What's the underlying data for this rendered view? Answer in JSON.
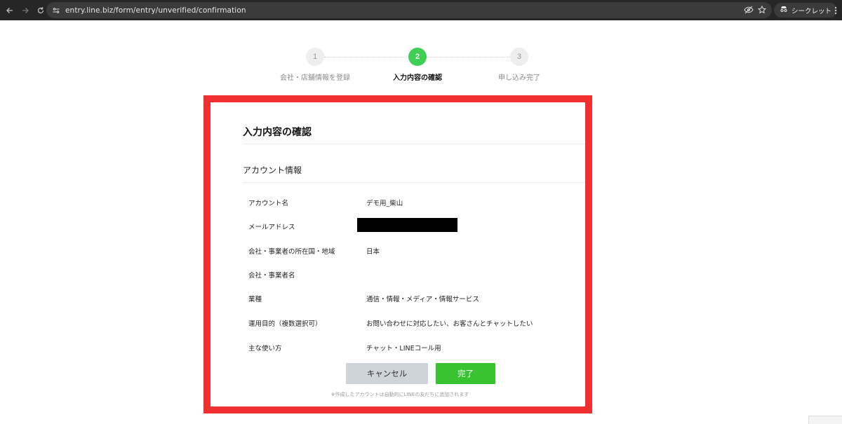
{
  "browser": {
    "url": "entry.line.biz/form/entry/unverified/confirmation",
    "incognito_label": "シークレット"
  },
  "stepper": {
    "steps": [
      {
        "number": "1",
        "label": "会社・店舗情報を登録",
        "state": "inactive"
      },
      {
        "number": "2",
        "label": "入力内容の確認",
        "state": "active"
      },
      {
        "number": "3",
        "label": "申し込み完了",
        "state": "inactive"
      }
    ],
    "active_color": "#3fcf55"
  },
  "card": {
    "title": "入力内容の確認",
    "section_title": "アカウント情報",
    "rows": [
      {
        "label": "アカウント名",
        "value": "デモ用_柴山"
      },
      {
        "label": "メールアドレス",
        "value": ""
      },
      {
        "label": "会社・事業者の所在国・地域",
        "value": "日本"
      },
      {
        "label": "会社・事業者名",
        "value": ""
      },
      {
        "label": "業種",
        "value": "通信・情報・メディア・情報サービス"
      },
      {
        "label": "運用目的（複数選択可）",
        "value": "お問い合わせに対応したい、お客さんとチャットしたい"
      },
      {
        "label": "主な使い方",
        "value": "チャット・LINEコール用"
      }
    ],
    "cancel_label": "キャンセル",
    "done_label": "完了",
    "footnote": "※作成したアカウントは自動的にLINEの友だちに追加されます"
  },
  "colors": {
    "highlight_border": "#f03030",
    "done_button": "#3ac331",
    "cancel_button": "#cfd3da"
  }
}
